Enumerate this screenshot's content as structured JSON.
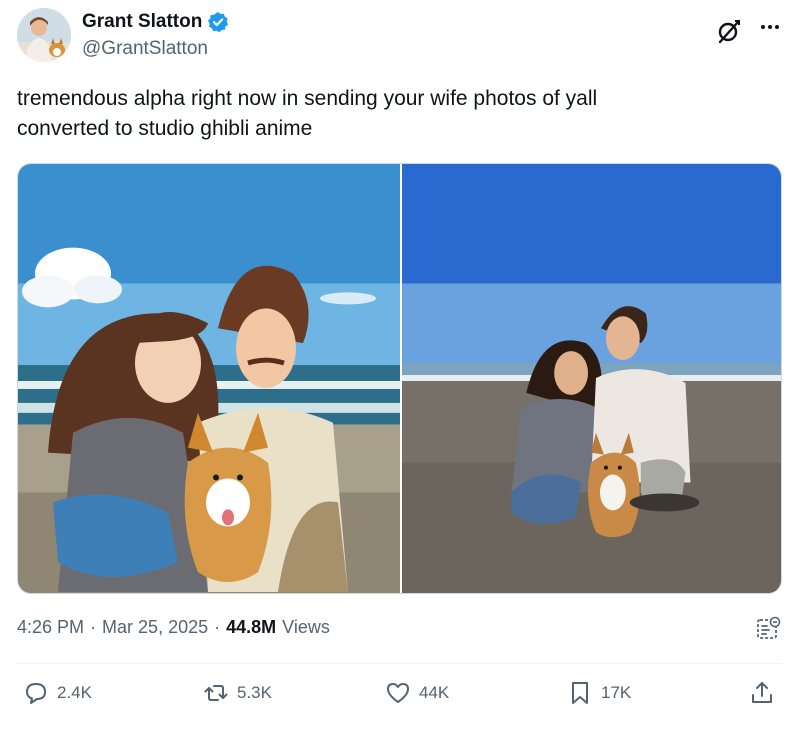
{
  "author": {
    "display_name": "Grant Slatton",
    "handle": "@GrantSlatton",
    "verified": true,
    "avatar_icon": "avatar-photo",
    "verified_color": "#1d9bf0"
  },
  "header_actions": {
    "grok_icon": "grok-icon",
    "more_icon": "more-dots-icon"
  },
  "tweet": {
    "text": "tremendous alpha right now in sending your wife photos of yall\nconverted to studio ghibli anime"
  },
  "media": {
    "left_image": "ghibli-anime-couple-with-corgi-on-beach",
    "right_image": "photo-couple-with-corgi-on-beach"
  },
  "meta": {
    "time": "4:26 PM",
    "separator": "·",
    "date": "Mar 25, 2025",
    "views_count": "44.8M",
    "views_label": "Views",
    "analytics_icon": "analytics-icon"
  },
  "actions": {
    "reply": {
      "icon": "reply-icon",
      "count": "2.4K"
    },
    "repost": {
      "icon": "repost-icon",
      "count": "5.3K"
    },
    "like": {
      "icon": "heart-icon",
      "count": "44K"
    },
    "bookmark": {
      "icon": "bookmark-icon",
      "count": "17K"
    },
    "share": {
      "icon": "share-icon"
    }
  },
  "colors": {
    "text_primary": "#0f1419",
    "text_secondary": "#536471",
    "border": "#cfd9de"
  }
}
